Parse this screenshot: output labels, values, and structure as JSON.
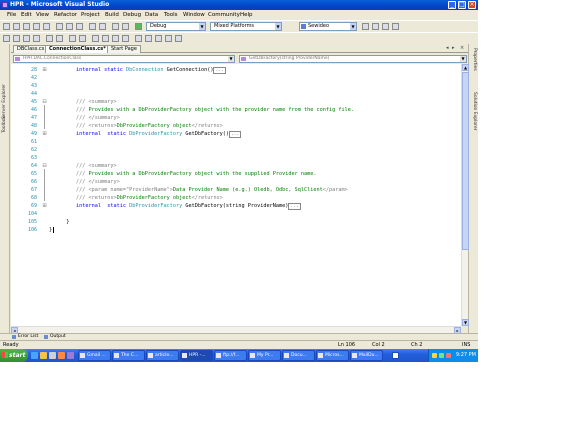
{
  "window": {
    "title": "HPR - Microsoft Visual Studio"
  },
  "menu": [
    "File",
    "Edit",
    "View",
    "Refactor",
    "Project",
    "Build",
    "Debug",
    "Data",
    "Tools",
    "Window",
    "Community",
    "Help"
  ],
  "toolbar": {
    "config": "Debug",
    "platform": "Mixed Platforms",
    "find": "Sewideo"
  },
  "tabs": [
    {
      "label": "DBClass.cs",
      "active": false
    },
    {
      "label": "ConnectionClass.cs*",
      "active": true
    },
    {
      "label": "Start Page",
      "active": false
    }
  ],
  "nav": {
    "type": "HPR.DAL.ConnectionClass",
    "member": "GetDbFactory(string ProviderName)"
  },
  "side": {
    "left": [
      "Server Explorer",
      "Toolbox"
    ],
    "right": [
      "Properties",
      "Solution Explorer"
    ]
  },
  "editor": {
    "lines": [
      {
        "num": "28",
        "outline": "+",
        "code": [
          {
            "t": "internal ",
            "c": "kw"
          },
          {
            "t": "static ",
            "c": "kw"
          },
          {
            "t": "DbConnection ",
            "c": "ty"
          },
          {
            "t": "GetConnection()"
          },
          {
            "t": "...",
            "c": "collapsed"
          }
        ]
      },
      {
        "num": "42",
        "code": []
      },
      {
        "num": "43",
        "code": []
      },
      {
        "num": "44",
        "code": []
      },
      {
        "num": "45",
        "outline": "-",
        "code": [
          {
            "t": "/// ",
            "c": "xml"
          },
          {
            "t": "<summary>",
            "c": "xml"
          }
        ]
      },
      {
        "num": "46",
        "code": [
          {
            "t": "/// ",
            "c": "xml"
          },
          {
            "t": "Provides with a DbProviderFactory object with the provider name from the config file.",
            "c": "cm"
          }
        ]
      },
      {
        "num": "47",
        "code": [
          {
            "t": "/// ",
            "c": "xml"
          },
          {
            "t": "</summary>",
            "c": "xml"
          }
        ]
      },
      {
        "num": "48",
        "code": [
          {
            "t": "/// ",
            "c": "xml"
          },
          {
            "t": "<returns>",
            "c": "xml"
          },
          {
            "t": "DbProviderFactory object",
            "c": "cm"
          },
          {
            "t": "</returns>",
            "c": "xml"
          }
        ]
      },
      {
        "num": "49",
        "outline": "+",
        "code": [
          {
            "t": "internal  ",
            "c": "kw"
          },
          {
            "t": "static ",
            "c": "kw"
          },
          {
            "t": "DbProviderFactory ",
            "c": "ty"
          },
          {
            "t": "GetDbFactory()"
          },
          {
            "t": "...",
            "c": "collapsed"
          }
        ]
      },
      {
        "num": "61",
        "code": []
      },
      {
        "num": "62",
        "code": []
      },
      {
        "num": "63",
        "code": []
      },
      {
        "num": "64",
        "outline": "-",
        "code": [
          {
            "t": "/// ",
            "c": "xml"
          },
          {
            "t": "<summary>",
            "c": "xml"
          }
        ]
      },
      {
        "num": "65",
        "code": [
          {
            "t": "/// ",
            "c": "xml"
          },
          {
            "t": "Provides with a DbProviderFactory object with the supplied Provider name.",
            "c": "cm"
          }
        ]
      },
      {
        "num": "66",
        "code": [
          {
            "t": "/// ",
            "c": "xml"
          },
          {
            "t": "</summary>",
            "c": "xml"
          }
        ]
      },
      {
        "num": "67",
        "code": [
          {
            "t": "/// ",
            "c": "xml"
          },
          {
            "t": "<param name=\"ProviderName\">",
            "c": "xml"
          },
          {
            "t": "Data Provider Name (e.g.) Oledb, Odbc, SqlClient",
            "c": "cm"
          },
          {
            "t": "</param>",
            "c": "xml"
          }
        ]
      },
      {
        "num": "68",
        "code": [
          {
            "t": "/// ",
            "c": "xml"
          },
          {
            "t": "<returns>",
            "c": "xml"
          },
          {
            "t": "DbProviderFactory object",
            "c": "cm"
          },
          {
            "t": "</returns>",
            "c": "xml"
          }
        ]
      },
      {
        "num": "69",
        "outline": "+",
        "code": [
          {
            "t": "internal  ",
            "c": "kw"
          },
          {
            "t": "static ",
            "c": "kw"
          },
          {
            "t": "DbProviderFactory ",
            "c": "ty"
          },
          {
            "t": "GetDbFactory(string ProviderName)"
          },
          {
            "t": "...",
            "c": "collapsed"
          }
        ]
      },
      {
        "num": "104",
        "code": []
      },
      {
        "num": "105",
        "code": [
          {
            "t": "  }"
          }
        ],
        "indent": "outer"
      },
      {
        "num": "106",
        "code": [
          {
            "t": "}"
          }
        ],
        "indent": "root",
        "caret": true
      }
    ]
  },
  "toolwindows": [
    "Error List",
    "Output"
  ],
  "status": {
    "left": "Ready",
    "ln": "Ln 106",
    "col": "Col 2",
    "ch": "Ch 2",
    "mode": "INS"
  },
  "taskbar": {
    "start": "start",
    "tasks": [
      {
        "label": "Gmail ..."
      },
      {
        "label": "The C..."
      },
      {
        "label": "article..."
      },
      {
        "label": "HPR -...",
        "active": true
      },
      {
        "label": "ftp://f..."
      },
      {
        "label": "My Pr..."
      },
      {
        "label": "Docu..."
      },
      {
        "label": "Micros..."
      },
      {
        "label": "MailDu..."
      }
    ],
    "clock": "9:27 PM"
  },
  "colors": {
    "titlebar": "#0a5fd8",
    "keyword": "#0000ff",
    "type": "#2b91af",
    "comment": "#008000",
    "xmldoc": "#808080"
  }
}
